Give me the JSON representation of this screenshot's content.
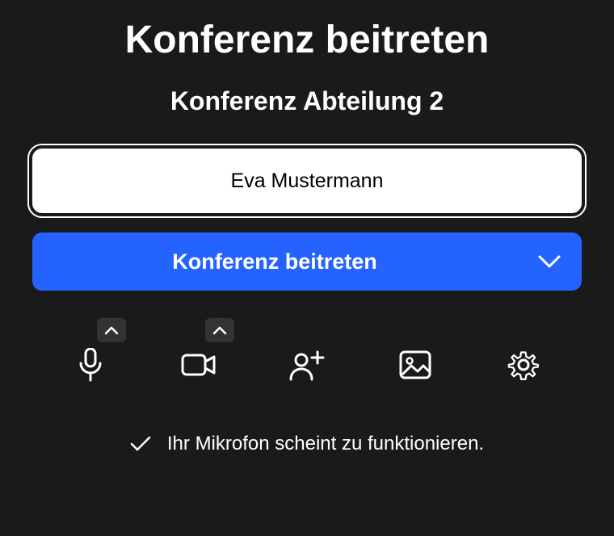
{
  "title": "Konferenz beitreten",
  "subtitle": "Konferenz Abteilung 2",
  "name_value": "Eva Mustermann",
  "join_label": "Konferenz beitreten",
  "status_text": "Ihr Mikrofon scheint zu funktionieren.",
  "colors": {
    "accent": "#2563ff"
  }
}
